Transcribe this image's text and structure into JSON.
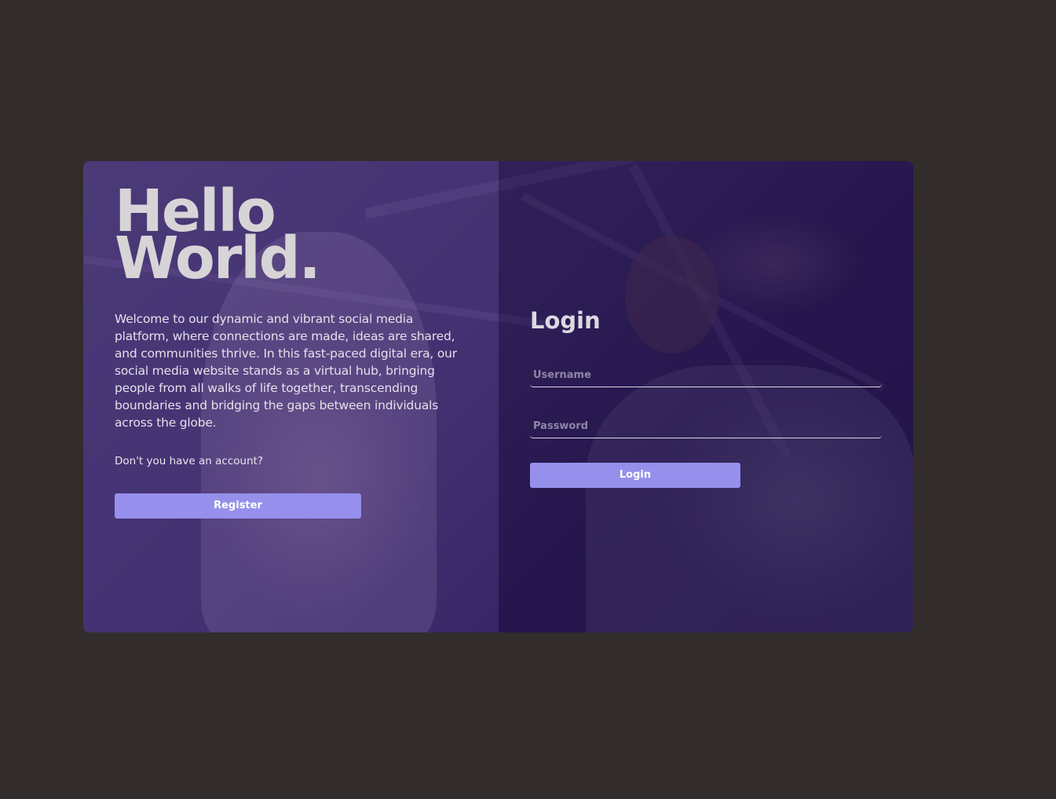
{
  "hero": {
    "headline_line1": "Hello",
    "headline_line2": "World.",
    "intro": "Welcome to our dynamic and vibrant social media platform, where connections are made, ideas are shared, and communities thrive. In this fast-paced digital era, our social media website stands as a virtual hub, bringing people from all walks of life together, transcending boundaries and bridging the gaps between individuals across the globe.",
    "no_account_text": "Don't you have an account?",
    "register_label": "Register"
  },
  "login": {
    "title": "Login",
    "username_placeholder": "Username",
    "password_placeholder": "Password",
    "submit_label": "Login"
  },
  "colors": {
    "page_background": "#322d2c",
    "button": "#9690ec",
    "overlay": "#3b2a63"
  }
}
